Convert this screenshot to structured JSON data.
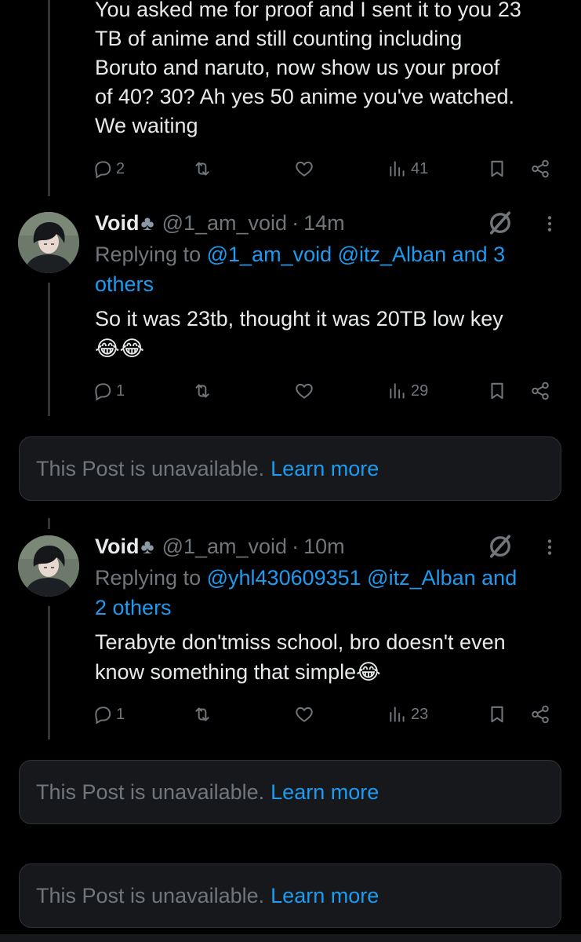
{
  "top_post": {
    "text": "You asked me for proof and I sent it to you 23\nTB of anime and still counting including\nBoruto and naruto, now show us your proof\nof 40? 30? Ah yes 50 anime you've watched.\nWe waiting",
    "replies": "2",
    "views": "41"
  },
  "reply1": {
    "name": "Void",
    "name_symbol": "♣",
    "handle": "@1_am_void",
    "dot": "·",
    "time": "14m",
    "replying_label": "Replying to",
    "replying_links": "@1_am_void @itz_Alban and 3",
    "replying_links2": "others",
    "body_line1": "So it was 23tb, thought it was 20TB low key",
    "body_emoji": "😂😂",
    "replies": "1",
    "views": "29"
  },
  "unavailable1": {
    "text": "This Post is unavailable.",
    "link": "Learn more"
  },
  "reply2": {
    "name": "Void",
    "name_symbol": "♣",
    "handle": "@1_am_void",
    "dot": "·",
    "time": "10m",
    "replying_label": "Replying to",
    "replying_links": "@yhl430609351 @itz_Alban and",
    "replying_links2": "2 others",
    "body_line1": "Terabyte don'tmiss school, bro doesn't even",
    "body_line2": "know something that simple",
    "body_emoji": "😂",
    "replies": "1",
    "views": "23"
  },
  "unavailable2": {
    "text": "This Post is unavailable.",
    "link": "Learn more"
  },
  "unavailable3": {
    "text": "This Post is unavailable.",
    "link": "Learn more"
  },
  "icons": {
    "reply": "reply-icon",
    "repost": "repost-icon",
    "like": "like-icon",
    "views": "views-icon",
    "bookmark": "bookmark-icon",
    "share": "share-icon",
    "grok": "grok-icon",
    "more": "more-icon"
  },
  "colors": {
    "background": "#000000",
    "text": "#e7e9ea",
    "muted": "#71767b",
    "link": "#1d9bf0",
    "card": "#16181c"
  }
}
